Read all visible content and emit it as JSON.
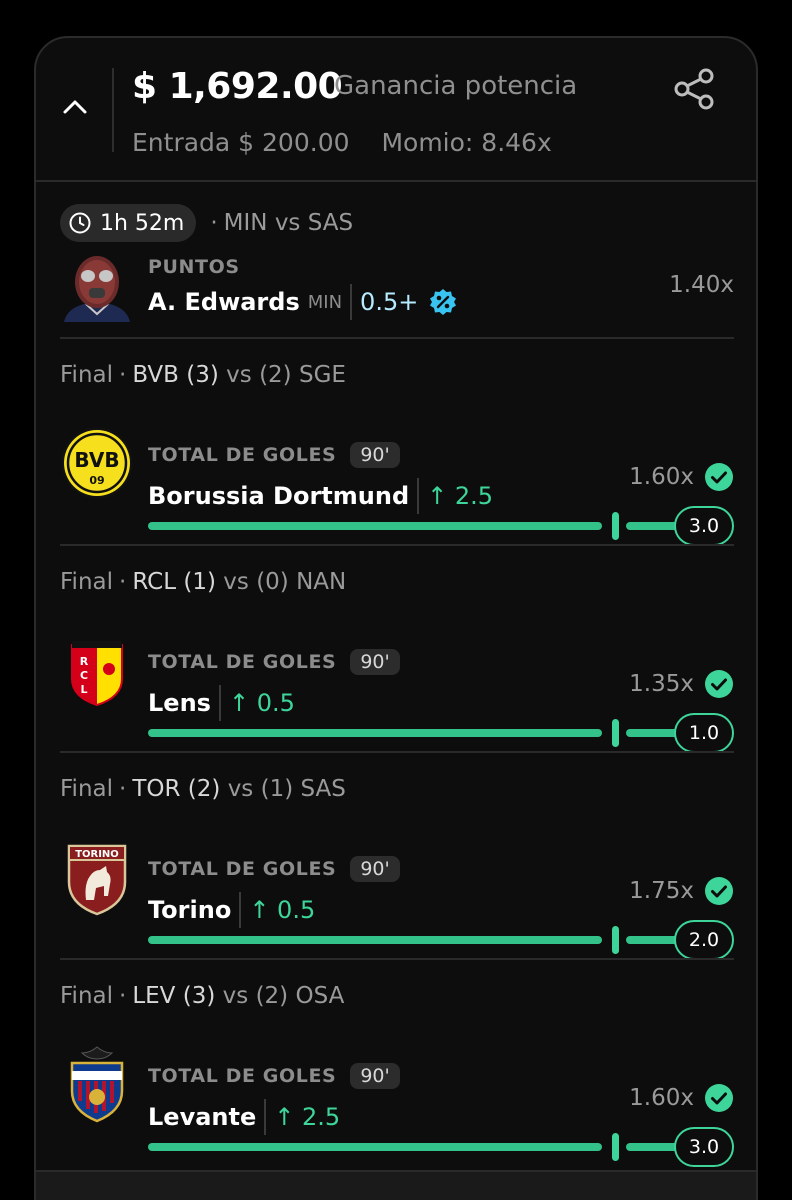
{
  "header": {
    "payout": "$ 1,692.00",
    "payout_label": "Ganancia potencia",
    "entry": "Entrada $ 200.00",
    "odds": "Momio: 8.46x"
  },
  "legs": [
    {
      "game_pill": "1h 52m",
      "game": "MIN vs SAS",
      "market": "PUNTOS",
      "selection": "A. Edwards",
      "team_abbr": "MIN",
      "line": "0.5+",
      "odds": "1.40x"
    },
    {
      "status": "Final",
      "home": "BVB",
      "home_score": "(3)",
      "vs": "vs",
      "away_score": "(2)",
      "away": "SGE",
      "market": "TOTAL DE GOLES",
      "period": "90'",
      "selection": "Borussia Dortmund",
      "line": "↑ 2.5",
      "odds": "1.60x",
      "result": "3.0",
      "progress": 1.0
    },
    {
      "status": "Final",
      "home": "RCL",
      "home_score": "(1)",
      "vs": "vs",
      "away_score": "(0)",
      "away": "NAN",
      "market": "TOTAL DE GOLES",
      "period": "90'",
      "selection": "Lens",
      "line": "↑ 0.5",
      "odds": "1.35x",
      "result": "1.0",
      "progress": 1.0
    },
    {
      "status": "Final",
      "home": "TOR",
      "home_score": "(2)",
      "vs": "vs",
      "away_score": "(1)",
      "away": "SAS",
      "market": "TOTAL DE GOLES",
      "period": "90'",
      "selection": "Torino",
      "line": "↑ 0.5",
      "odds": "1.75x",
      "result": "2.0",
      "progress": 1.0
    },
    {
      "status": "Final",
      "home": "LEV",
      "home_score": "(3)",
      "vs": "vs",
      "away_score": "(2)",
      "away": "OSA",
      "market": "TOTAL DE GOLES",
      "period": "90'",
      "selection": "Levante",
      "line": "↑ 2.5",
      "odds": "1.60x",
      "result": "3.0",
      "progress": 1.0
    }
  ],
  "colors": {
    "accent": "#3ed59a",
    "bg": "#0d0d0d",
    "muted": "#8f8f8f",
    "boost": "#38c3f0"
  }
}
